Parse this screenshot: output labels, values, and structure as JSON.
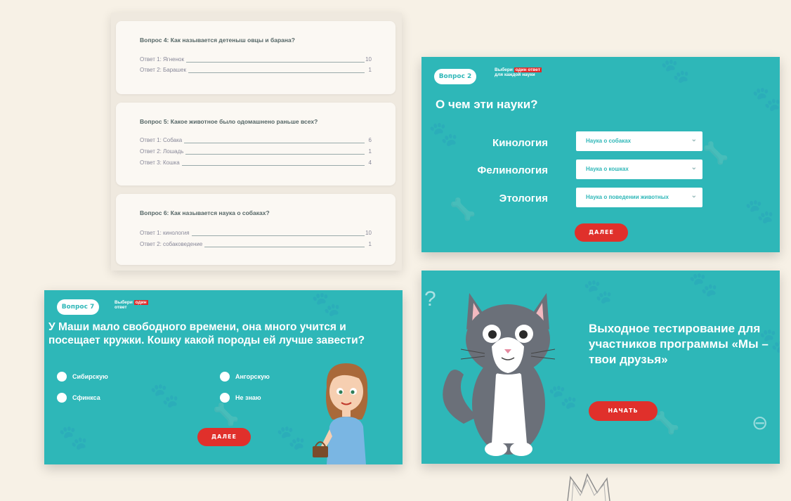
{
  "results": {
    "questions": [
      {
        "title": "Вопрос 4: Как называется детеныш овцы и барана?",
        "answers": [
          {
            "label": "Ответ 1: Ягненок",
            "count": "10"
          },
          {
            "label": "Ответ 2: Барашек",
            "count": "1"
          }
        ]
      },
      {
        "title": "Вопрос 5: Какое животное было одомашнено раньше всех?",
        "answers": [
          {
            "label": "Ответ 1: Собака",
            "count": "6"
          },
          {
            "label": "Ответ 2: Лошадь",
            "count": "1"
          },
          {
            "label": "Ответ 3: Кошка",
            "count": "4"
          }
        ]
      },
      {
        "title": "Вопрос 6: Как называется наука о собаках?",
        "answers": [
          {
            "label": "Ответ 1: кинология",
            "count": "10"
          },
          {
            "label": "Ответ 2: собаковедение",
            "count": "1"
          }
        ]
      }
    ]
  },
  "slide_sciences": {
    "badge": "Вопрос 2",
    "logo_prefix": "Выбери",
    "logo_highlight": "один ответ",
    "logo_suffix": "для каждой науки",
    "title": "О чем эти науки?",
    "rows": [
      {
        "term": "Кинология",
        "value": "Наука о собаках"
      },
      {
        "term": "Фелинология",
        "value": "Наука о кошках"
      },
      {
        "term": "Этология",
        "value": "Наука о поведении животных"
      }
    ],
    "next_label": "ДАЛЕЕ"
  },
  "slide_cat_breed": {
    "badge": "Вопрос 7",
    "logo_prefix": "Выбери",
    "logo_highlight": "один",
    "logo_suffix": "ответ",
    "question": "У Маши мало свободного времени, она много учится и посещает кружки. Кошку какой породы ей лучше завести?",
    "options": [
      "Сибирскую",
      "Ангорскую",
      "Сфинкса",
      "Не знаю"
    ],
    "next_label": "ДАЛЕЕ"
  },
  "slide_start": {
    "title": "Выходное тестирование для участников программы «Мы – твои друзья»",
    "start_label": "НАЧАТЬ"
  },
  "colors": {
    "teal": "#2eb7b8",
    "red": "#e0302b",
    "background": "#f7f1e6"
  }
}
